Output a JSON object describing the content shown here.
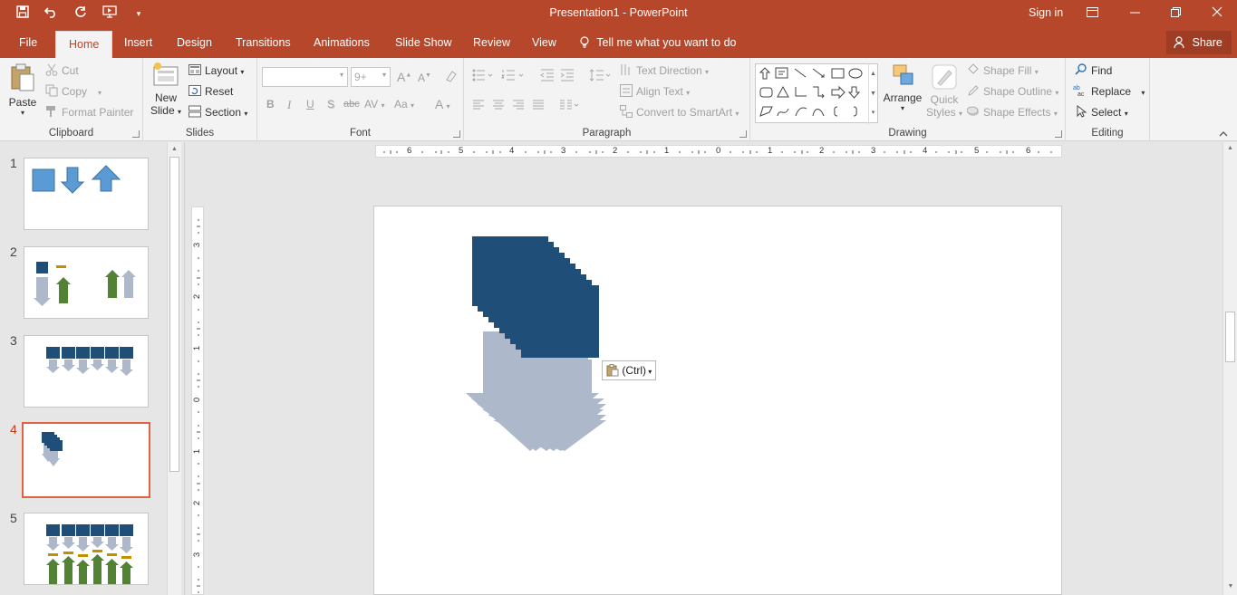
{
  "window": {
    "title": "Presentation1 - PowerPoint",
    "signin": "Sign in"
  },
  "tabs": [
    "File",
    "Home",
    "Insert",
    "Design",
    "Transitions",
    "Animations",
    "Slide Show",
    "Review",
    "View"
  ],
  "active_tab": "Home",
  "tell_me": "Tell me what you want to do",
  "share": "Share",
  "ribbon": {
    "clipboard": {
      "label": "Clipboard",
      "paste": "Paste",
      "cut": "Cut",
      "copy": "Copy",
      "format_painter": "Format Painter"
    },
    "slides": {
      "label": "Slides",
      "new_slide_1": "New",
      "new_slide_2": "Slide",
      "layout": "Layout",
      "reset": "Reset",
      "section": "Section"
    },
    "font": {
      "label": "Font",
      "size": "9+",
      "bold": "B",
      "italic": "I",
      "underline": "U",
      "shadow": "S",
      "strike": "abc",
      "spacing": "AV",
      "case": "Aa",
      "color": "A",
      "grow": "A",
      "shrink": "A"
    },
    "paragraph": {
      "label": "Paragraph",
      "text_direction": "Text Direction",
      "align_text": "Align Text",
      "convert": "Convert to SmartArt"
    },
    "drawing": {
      "label": "Drawing",
      "arrange": "Arrange",
      "quick_1": "Quick",
      "quick_2": "Styles",
      "fill": "Shape Fill",
      "outline": "Shape Outline",
      "effects": "Shape Effects"
    },
    "editing": {
      "label": "Editing",
      "find": "Find",
      "replace": "Replace",
      "select": "Select"
    }
  },
  "slides": [
    {
      "number": "1"
    },
    {
      "number": "2"
    },
    {
      "number": "3"
    },
    {
      "number": "4",
      "selected": true
    },
    {
      "number": "5"
    }
  ],
  "hruler_labels": [
    "6",
    "5",
    "4",
    "3",
    "2",
    "1",
    "0",
    "1",
    "2",
    "3",
    "4",
    "5",
    "6"
  ],
  "vruler_labels": [
    "3",
    "2",
    "1",
    "0",
    "1",
    "2",
    "3"
  ],
  "paste_options": "(Ctrl)",
  "colors": {
    "accent": "#b7472a",
    "navy": "#1f4e79",
    "gray_arrow": "#adb9ca",
    "blue_shape": "#5b9bd5",
    "green": "#548235",
    "gold": "#bf9000",
    "selected_border": "#e0633f"
  }
}
